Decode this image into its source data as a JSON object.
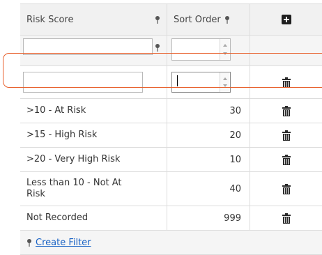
{
  "columns": {
    "risk_score": "Risk Score",
    "sort_order": "Sort Order"
  },
  "header_icons": {
    "filter": "pin-icon",
    "add": "plus-square-icon"
  },
  "filter_row": {
    "risk_score_value": "",
    "sort_order_value": ""
  },
  "edit_row": {
    "risk_score_value": "",
    "sort_order_value": ""
  },
  "rows": [
    {
      "label": ">10 - At Risk",
      "order": "30"
    },
    {
      "label": ">15 - High Risk",
      "order": "20"
    },
    {
      "label": ">20 - Very High Risk",
      "order": "10"
    },
    {
      "label": "Less than 10 - Not At Risk",
      "order": "40"
    },
    {
      "label": "Not Recorded",
      "order": "999"
    }
  ],
  "footer": {
    "create_filter": "Create Filter"
  },
  "colors": {
    "highlight": "#e8602c",
    "link": "#1a63c5"
  }
}
